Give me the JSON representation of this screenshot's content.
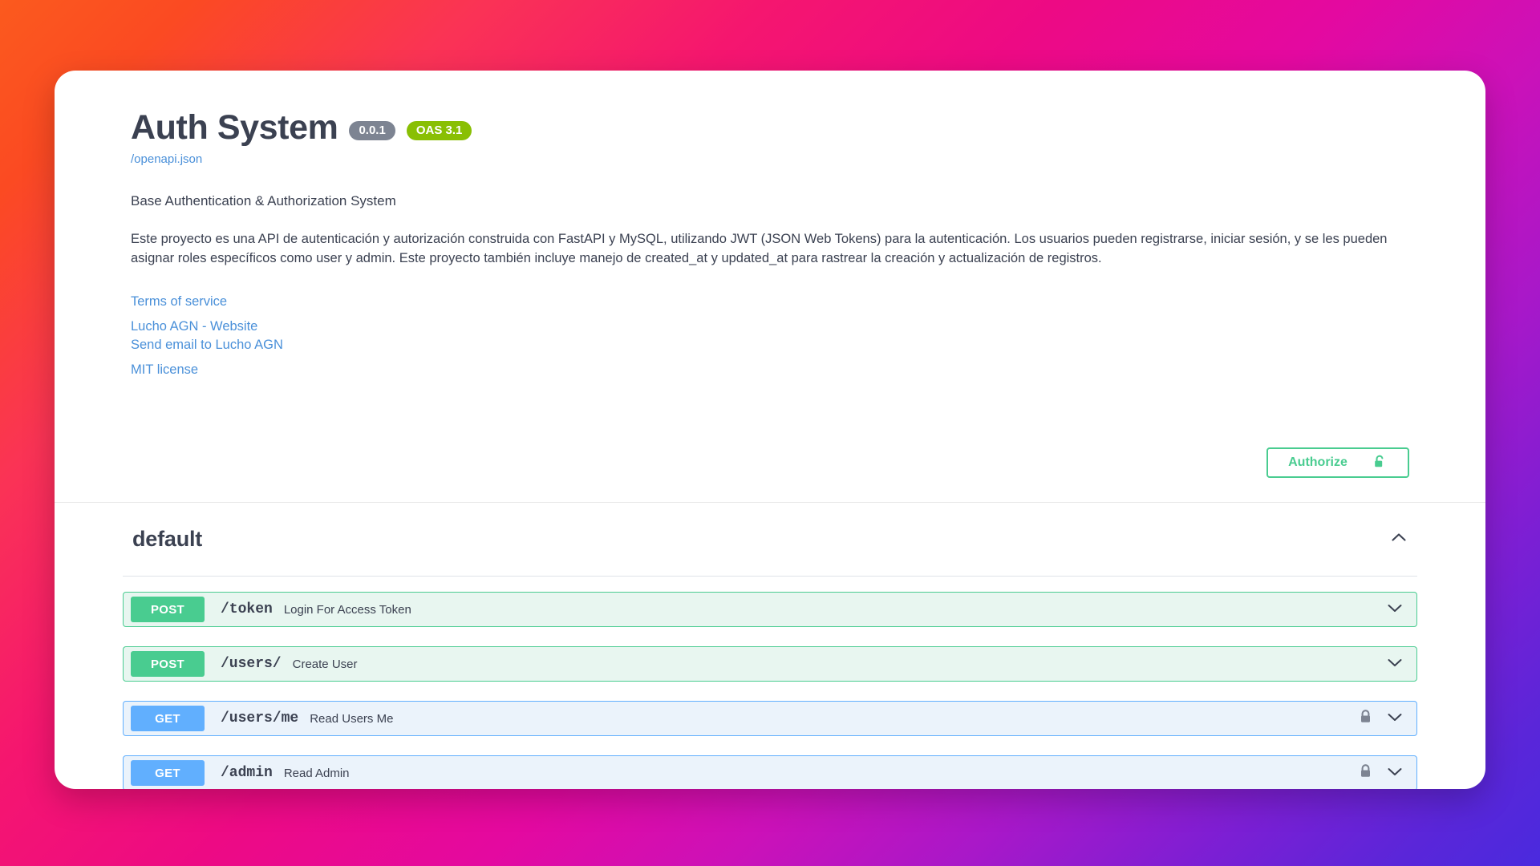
{
  "api": {
    "title": "Auth System",
    "version_badge": "0.0.1",
    "oas_badge": "OAS 3.1",
    "spec_link": "/openapi.json",
    "summary": "Base Authentication & Authorization System",
    "description": "Este proyecto es una API de autenticación y autorización construida con FastAPI y MySQL, utilizando JWT (JSON Web Tokens) para la autenticación. Los usuarios pueden registrarse, iniciar sesión, y se les pueden asignar roles específicos como user y admin. Este proyecto también incluye manejo de created_at y updated_at para rastrear la creación y actualización de registros.",
    "terms_link": "Terms of service",
    "contact_website": "Lucho AGN - Website",
    "contact_email": "Send email to Lucho AGN",
    "license": "MIT license"
  },
  "authorize": {
    "label": "Authorize",
    "icon": "unlock-icon"
  },
  "tag": {
    "name": "default",
    "expanded": true,
    "collapse_icon": "chevron-up-icon"
  },
  "operations": [
    {
      "method": "POST",
      "method_class": "post",
      "path": "/token",
      "summary": "Login For Access Token",
      "locked": false,
      "expand_icon": "chevron-down-icon"
    },
    {
      "method": "POST",
      "method_class": "post",
      "path": "/users/",
      "summary": "Create User",
      "locked": false,
      "expand_icon": "chevron-down-icon"
    },
    {
      "method": "GET",
      "method_class": "get",
      "path": "/users/me",
      "summary": "Read Users Me",
      "locked": true,
      "lock_icon": "lock-icon",
      "expand_icon": "chevron-down-icon"
    },
    {
      "method": "GET",
      "method_class": "get",
      "path": "/admin",
      "summary": "Read Admin",
      "locked": true,
      "lock_icon": "lock-icon",
      "expand_icon": "chevron-down-icon"
    }
  ],
  "colors": {
    "post_green": "#49cc90",
    "get_blue": "#61affe",
    "oas_green": "#89bf04",
    "version_gray": "#7d8492",
    "link_blue": "#4a90d9",
    "text_dark": "#3b4151"
  }
}
